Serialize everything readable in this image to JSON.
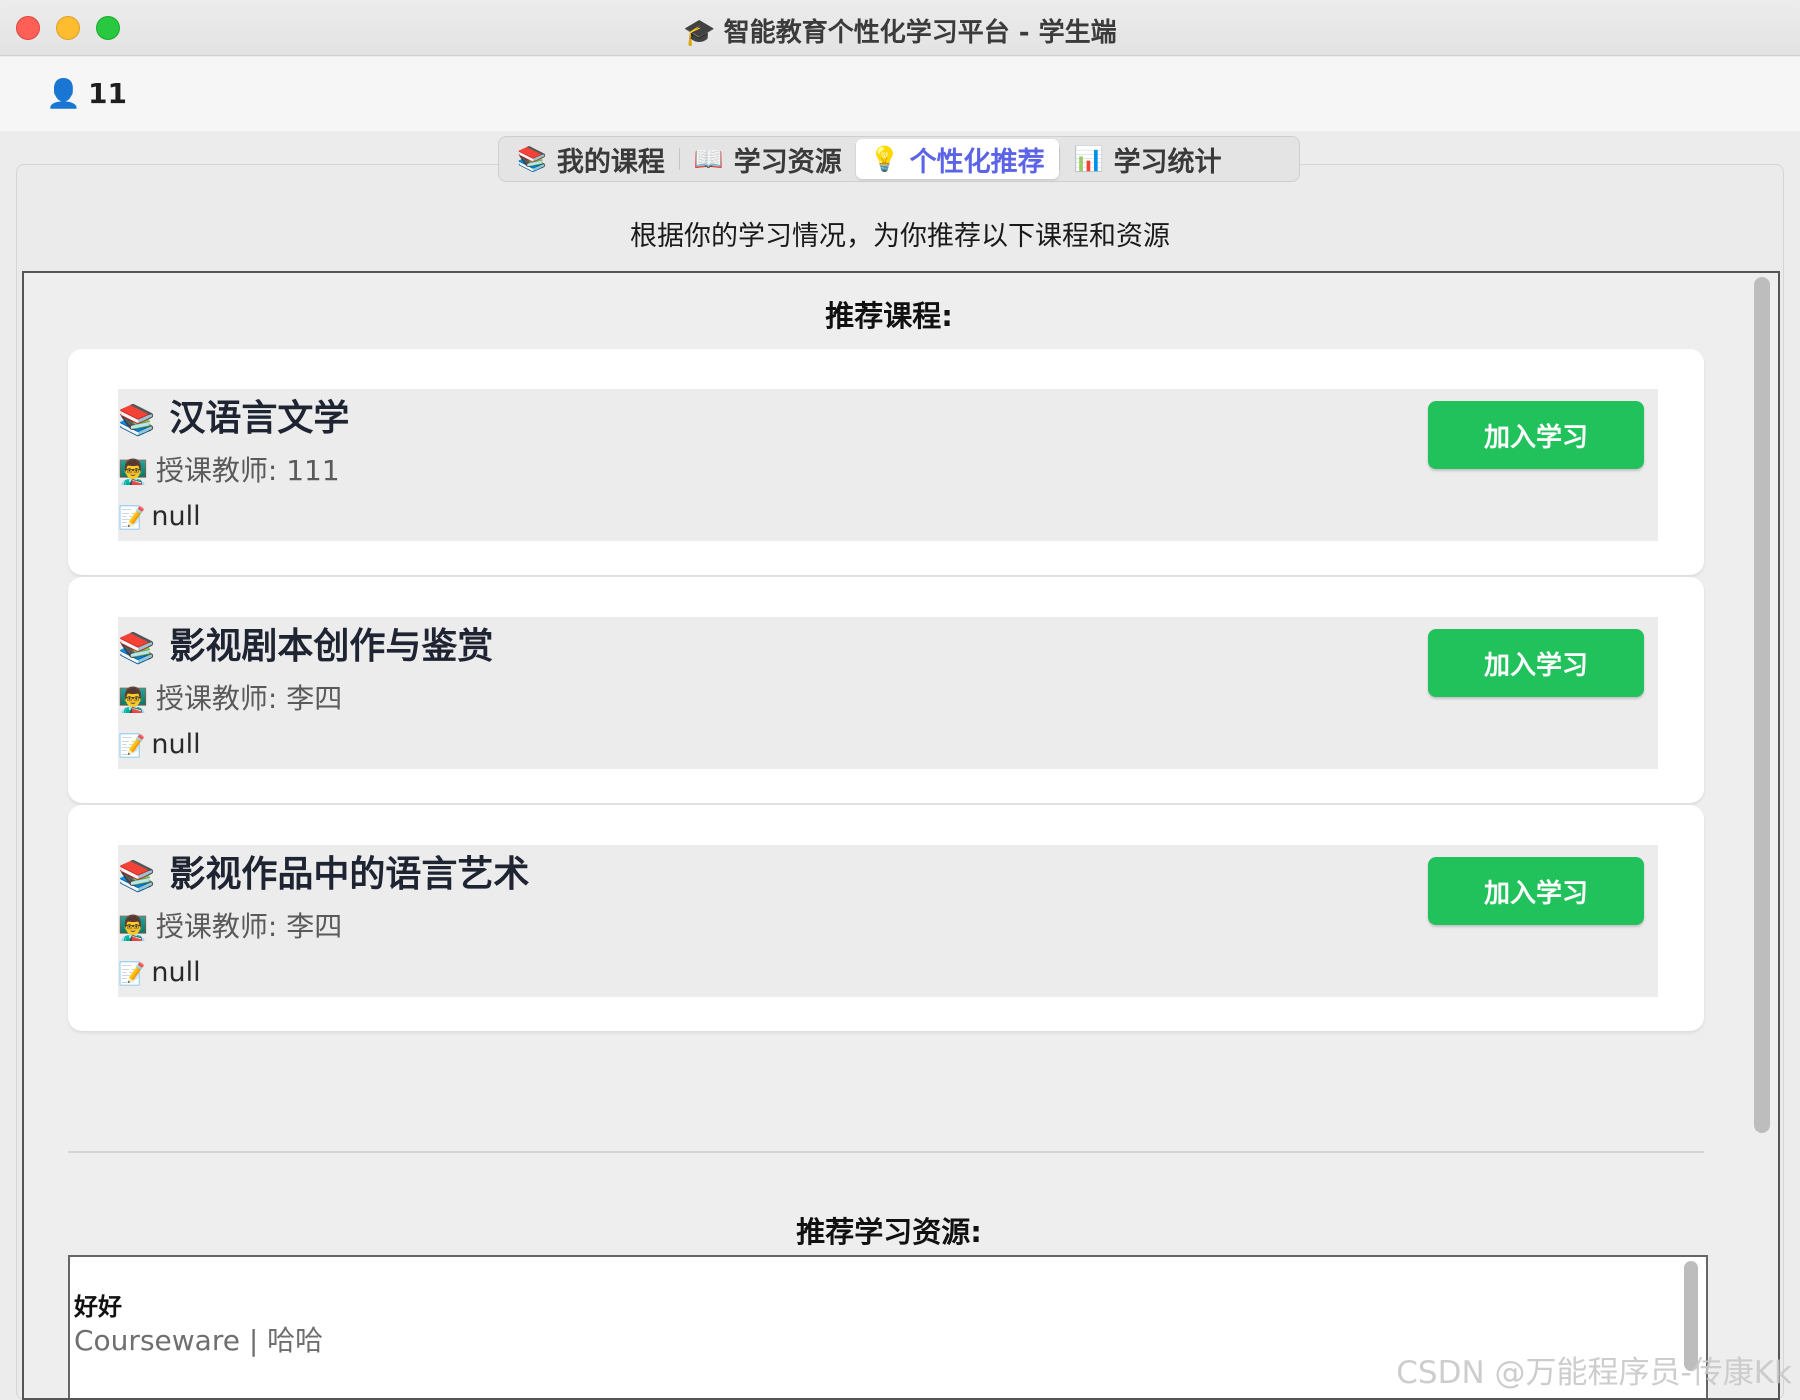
{
  "window": {
    "title": "智能教育个性化学习平台 - 学生端",
    "title_icon": "graduation-cap-icon"
  },
  "user": {
    "icon": "user-icon",
    "name": "11"
  },
  "tabs": [
    {
      "label": "我的课程",
      "icon": "books-icon",
      "active": false
    },
    {
      "label": "学习资源",
      "icon": "open-book-icon",
      "active": false
    },
    {
      "label": "个性化推荐",
      "icon": "lightbulb-icon",
      "active": true
    },
    {
      "label": "学习统计",
      "icon": "bar-chart-icon",
      "active": false
    }
  ],
  "recommend": {
    "subtitle": "根据你的学习情况，为你推荐以下课程和资源",
    "courses_title": "推荐课程:",
    "courses": [
      {
        "name": "汉语言文学",
        "teacher": "授课教师: 111",
        "description": "null",
        "action": "加入学习"
      },
      {
        "name": "影视剧本创作与鉴赏",
        "teacher": "授课教师: 李四",
        "description": "null",
        "action": "加入学习"
      },
      {
        "name": "影视作品中的语言艺术",
        "teacher": "授课教师: 李四",
        "description": "null",
        "action": "加入学习"
      }
    ],
    "resources_title": "推荐学习资源:",
    "resources": [
      {
        "title": "好好",
        "meta": "Courseware | 哈哈"
      }
    ]
  },
  "watermark": "CSDN @万能程序员-传康Kk",
  "colors": {
    "accent": "#5b63e6",
    "join_button": "#21c15b"
  }
}
